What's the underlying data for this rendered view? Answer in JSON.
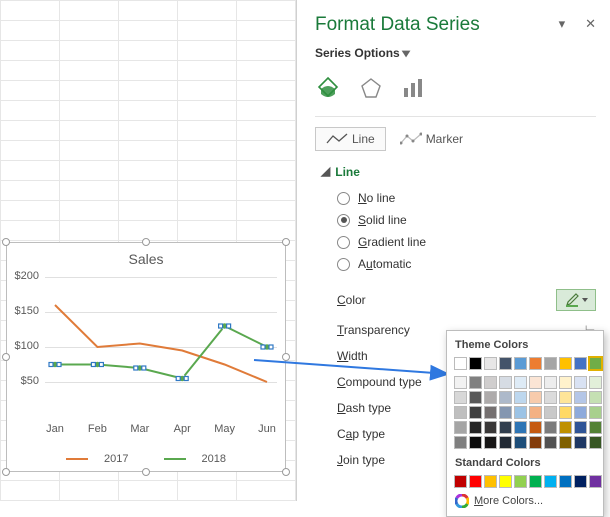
{
  "grid": {
    "rows": 25,
    "cols": 5
  },
  "chart": {
    "title": "Sales",
    "legend": [
      "2017",
      "2018"
    ],
    "colors": {
      "s2017": "#e07b39",
      "s2018": "#5aa84f"
    }
  },
  "chart_data": {
    "type": "line",
    "title": "Sales",
    "categories": [
      "Jan",
      "Feb",
      "Mar",
      "Apr",
      "May",
      "Jun"
    ],
    "series": [
      {
        "name": "2017",
        "values": [
          160,
          100,
          105,
          95,
          75,
          50
        ]
      },
      {
        "name": "2018",
        "values": [
          75,
          75,
          70,
          55,
          130,
          100
        ]
      }
    ],
    "ylabel": "",
    "ylim": [
      0,
      200
    ],
    "yticks": [
      50,
      100,
      150,
      200
    ],
    "selected_series": "2018"
  },
  "pane": {
    "title": "Format Data Series",
    "series_options": "Series Options",
    "tabs": {
      "line": "Line",
      "marker": "Marker"
    },
    "section": "Line",
    "radios": {
      "none": "No line",
      "solid": "Solid line",
      "gradient": "Gradient line",
      "auto": "Automatic",
      "selected": "solid"
    },
    "props": {
      "color": "Color",
      "transparency": "Transparency",
      "width": "Width",
      "compound": "Compound type",
      "dash": "Dash type",
      "cap": "Cap type",
      "join": "Join type"
    }
  },
  "palette": {
    "theme_label": "Theme Colors",
    "standard_label": "Standard Colors",
    "more": "More Colors...",
    "theme_row1": [
      "#ffffff",
      "#000000",
      "#e7e6e6",
      "#44546a",
      "#5b9bd5",
      "#ed7d31",
      "#a5a5a5",
      "#ffc000",
      "#4472c4",
      "#70ad47"
    ],
    "theme_shades": [
      [
        "#f2f2f2",
        "#808080",
        "#d0cece",
        "#d6dce4",
        "#deebf6",
        "#fbe5d5",
        "#ededed",
        "#fff2cc",
        "#d9e2f3",
        "#e2efd9"
      ],
      [
        "#d8d8d8",
        "#595959",
        "#aeabab",
        "#adb9ca",
        "#bdd7ee",
        "#f7cbac",
        "#dbdbdb",
        "#fee599",
        "#b4c6e7",
        "#c5e0b3"
      ],
      [
        "#bfbfbf",
        "#3f3f3f",
        "#757070",
        "#8496b0",
        "#9cc3e5",
        "#f4b183",
        "#c9c9c9",
        "#ffd965",
        "#8eaadb",
        "#a8d08d"
      ],
      [
        "#a5a5a5",
        "#262626",
        "#3a3838",
        "#323f4f",
        "#2e75b5",
        "#c55a11",
        "#7b7b7b",
        "#bf9000",
        "#2f5496",
        "#538135"
      ],
      [
        "#7f7f7f",
        "#0c0c0c",
        "#171616",
        "#222a35",
        "#1e4e79",
        "#833c0b",
        "#525252",
        "#7f6000",
        "#1f3864",
        "#375623"
      ]
    ],
    "standard": [
      "#c00000",
      "#ff0000",
      "#ffc000",
      "#ffff00",
      "#92d050",
      "#00b050",
      "#00b0f0",
      "#0070c0",
      "#002060",
      "#7030a0"
    ],
    "selected_hex": "#70ad47"
  }
}
